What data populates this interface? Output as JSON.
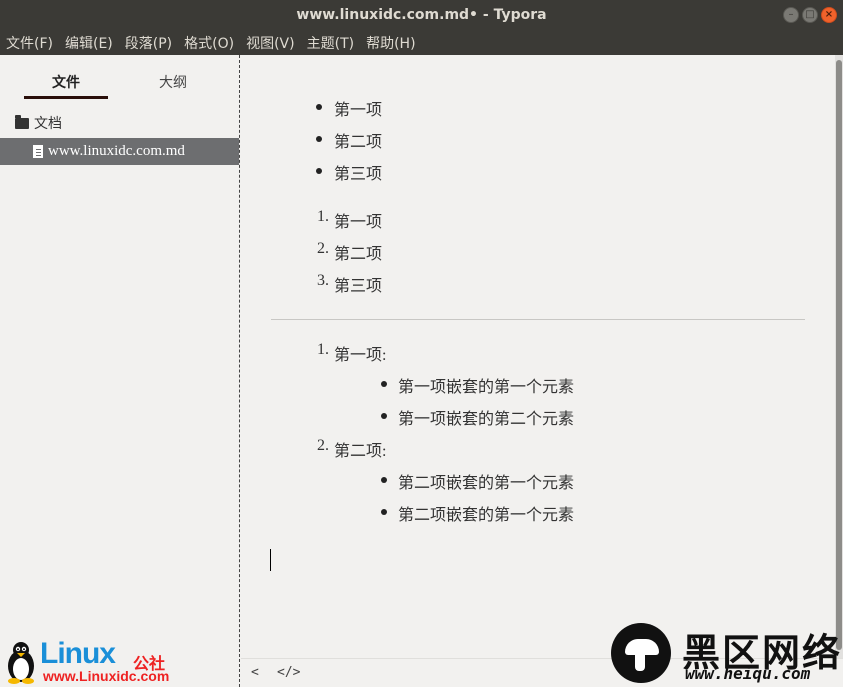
{
  "window": {
    "title": "www.linuxidc.com.md• - Typora",
    "minimize_glyph": "–",
    "maximize_glyph": "□",
    "close_glyph": "×"
  },
  "menu": {
    "items": [
      "文件(F)",
      "编辑(E)",
      "段落(P)",
      "格式(O)",
      "视图(V)",
      "主题(T)",
      "帮助(H)"
    ]
  },
  "sidebar": {
    "tab_files": "文件",
    "tab_outline": "大纲",
    "folder_label": "文档",
    "file_label": "www.linuxidc.com.md"
  },
  "document": {
    "unordered": [
      "第一项",
      "第二项",
      "第三项"
    ],
    "ordered": [
      {
        "num": "1.",
        "text": "第一项"
      },
      {
        "num": "2.",
        "text": "第二项"
      },
      {
        "num": "3.",
        "text": "第三项"
      }
    ],
    "nested": [
      {
        "num": "1.",
        "text": "第一项:",
        "children": [
          "第一项嵌套的第一个元素",
          "第一项嵌套的第二个元素"
        ]
      },
      {
        "num": "2.",
        "text": "第二项:",
        "children": [
          "第二项嵌套的第一个元素",
          "第二项嵌套的第一个元素"
        ]
      }
    ]
  },
  "statusbar": {
    "toggle_sidebar": "<",
    "source_mode": "</>"
  },
  "watermark_left": {
    "brand": "Linux",
    "suffix": "公社",
    "url": "www.Linuxidc.com"
  },
  "watermark_right": {
    "brand": "黑区网络",
    "url": "www.heiqu.com"
  },
  "colors": {
    "titlebar": "#3b3a36",
    "close_button": "#f0622b",
    "selected_file": "#6d6e70",
    "linux_blue": "#1a8fd8",
    "linux_red": "#e22"
  }
}
